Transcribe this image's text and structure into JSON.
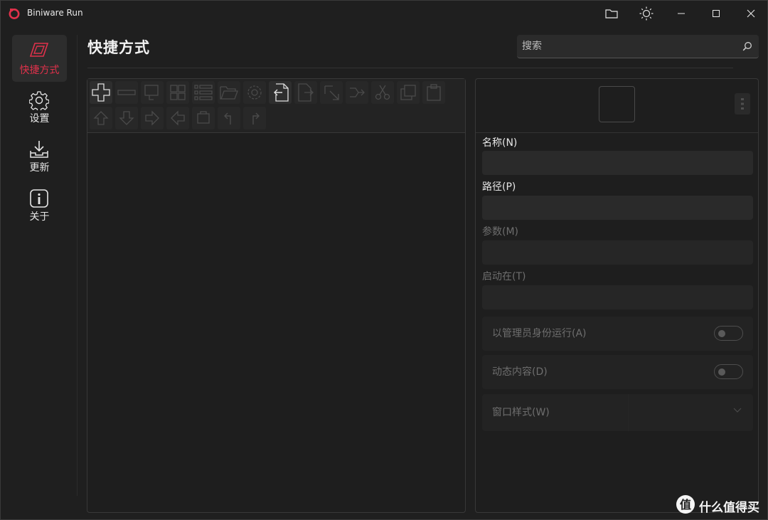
{
  "app": {
    "title": "Biniware Run",
    "accent": "#e0314b"
  },
  "titlebar": {
    "icons": [
      "folder-icon",
      "theme-sun-icon",
      "minimize-icon",
      "maximize-icon",
      "close-icon"
    ]
  },
  "sidebar": {
    "items": [
      {
        "label": "快捷方式",
        "icon": "shortcut-icon",
        "active": true
      },
      {
        "label": "设置",
        "icon": "gear-icon",
        "active": false
      },
      {
        "label": "更新",
        "icon": "download-icon",
        "active": false
      },
      {
        "label": "关于",
        "icon": "info-icon",
        "active": false
      }
    ]
  },
  "header": {
    "title": "快捷方式",
    "search_placeholder": "搜索"
  },
  "toolbar": {
    "tools": [
      {
        "icon": "add-icon",
        "enabled": true
      },
      {
        "icon": "remove-icon",
        "enabled": false
      },
      {
        "icon": "add-group-icon",
        "enabled": false
      },
      {
        "icon": "grid-view-icon",
        "enabled": false
      },
      {
        "icon": "list-view-icon",
        "enabled": false
      },
      {
        "icon": "open-folder-icon",
        "enabled": false
      },
      {
        "icon": "settings-icon",
        "enabled": false
      },
      {
        "icon": "import-icon",
        "enabled": true
      },
      {
        "icon": "export-icon",
        "enabled": false
      },
      {
        "icon": "run-icon",
        "enabled": false
      },
      {
        "icon": "merge-icon",
        "enabled": false
      },
      {
        "icon": "cut-icon",
        "enabled": false
      },
      {
        "icon": "copy-icon",
        "enabled": false
      },
      {
        "icon": "paste-icon",
        "enabled": false
      },
      {
        "icon": "move-up-icon",
        "enabled": false
      },
      {
        "icon": "move-down-icon",
        "enabled": false
      },
      {
        "icon": "move-right-icon",
        "enabled": false
      },
      {
        "icon": "move-left-icon",
        "enabled": false
      },
      {
        "icon": "refresh-icon",
        "enabled": false
      },
      {
        "icon": "undo-icon",
        "enabled": false
      },
      {
        "icon": "redo-icon",
        "enabled": false
      }
    ]
  },
  "properties": {
    "name_label": "名称(N)",
    "name_value": "",
    "path_label": "路径(P)",
    "path_value": "",
    "params_label": "参数(M)",
    "params_value": "",
    "startin_label": "启动在(T)",
    "startin_value": "",
    "run_as_admin_label": "以管理员身份运行(A)",
    "run_as_admin": false,
    "dynamic_content_label": "动态内容(D)",
    "dynamic_content": false,
    "window_style_label": "窗口样式(W)",
    "window_style_value": ""
  },
  "watermark": {
    "text": "什么值得买",
    "icon": "smzdm-logo-icon"
  }
}
